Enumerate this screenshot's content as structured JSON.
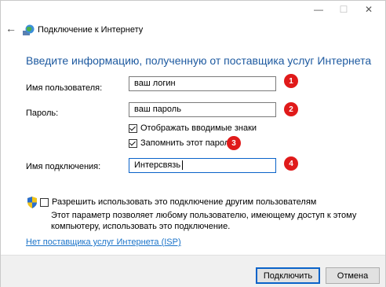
{
  "titlebar": {
    "minimize_glyph": "—",
    "maximize_glyph": "☐",
    "close_glyph": "✕"
  },
  "header": {
    "back_icon": "back-arrow-icon",
    "app_icon": "network-globe-icon",
    "title": "Подключение к Интернету"
  },
  "heading": "Введите информацию, полученную от поставщика услуг Интернета",
  "form": {
    "username_label": "Имя пользователя:",
    "username_value": "ваш логин",
    "password_label": "Пароль:",
    "password_value": "ваш пароль",
    "show_chars_label": "Отображать вводимые знаки",
    "show_chars_checked": true,
    "remember_label": "Запомнить этот пароль",
    "remember_checked": true,
    "connection_name_label": "Имя подключения:",
    "connection_name_value": "Интерсвязь"
  },
  "annotations": [
    "1",
    "2",
    "3",
    "4"
  ],
  "annotation_color": "#e01a1a",
  "sharing": {
    "icon": "uac-shield-icon",
    "checkbox_label": "Разрешить использовать это подключение другим пользователям",
    "checked": false,
    "description": "Этот параметр позволяет любому пользователю, имеющему доступ к этому компьютеру, использовать это подключение."
  },
  "isp_link": "Нет поставщика услуг Интернета (ISP)",
  "buttons": {
    "connect": "Подключить",
    "cancel": "Отмена"
  },
  "colors": {
    "heading": "#1e5aa0",
    "link": "#1a73c9",
    "focus": "#0a63c9"
  }
}
